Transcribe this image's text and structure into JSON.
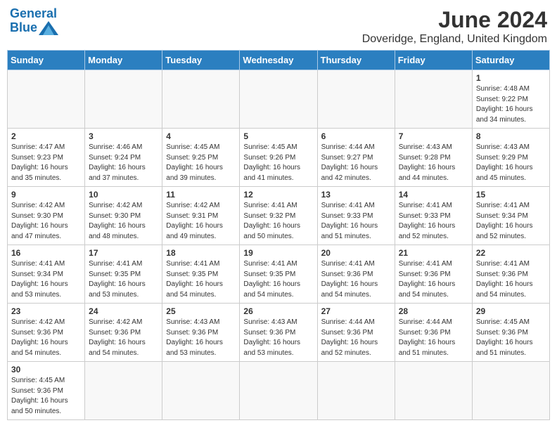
{
  "header": {
    "logo_line1": "General",
    "logo_line2": "Blue",
    "title": "June 2024",
    "subtitle": "Doveridge, England, United Kingdom"
  },
  "weekdays": [
    "Sunday",
    "Monday",
    "Tuesday",
    "Wednesday",
    "Thursday",
    "Friday",
    "Saturday"
  ],
  "weeks": [
    [
      {
        "day": "",
        "info": ""
      },
      {
        "day": "",
        "info": ""
      },
      {
        "day": "",
        "info": ""
      },
      {
        "day": "",
        "info": ""
      },
      {
        "day": "",
        "info": ""
      },
      {
        "day": "",
        "info": ""
      },
      {
        "day": "1",
        "info": "Sunrise: 4:48 AM\nSunset: 9:22 PM\nDaylight: 16 hours\nand 34 minutes."
      }
    ],
    [
      {
        "day": "2",
        "info": "Sunrise: 4:47 AM\nSunset: 9:23 PM\nDaylight: 16 hours\nand 35 minutes."
      },
      {
        "day": "3",
        "info": "Sunrise: 4:46 AM\nSunset: 9:24 PM\nDaylight: 16 hours\nand 37 minutes."
      },
      {
        "day": "4",
        "info": "Sunrise: 4:45 AM\nSunset: 9:25 PM\nDaylight: 16 hours\nand 39 minutes."
      },
      {
        "day": "5",
        "info": "Sunrise: 4:45 AM\nSunset: 9:26 PM\nDaylight: 16 hours\nand 41 minutes."
      },
      {
        "day": "6",
        "info": "Sunrise: 4:44 AM\nSunset: 9:27 PM\nDaylight: 16 hours\nand 42 minutes."
      },
      {
        "day": "7",
        "info": "Sunrise: 4:43 AM\nSunset: 9:28 PM\nDaylight: 16 hours\nand 44 minutes."
      },
      {
        "day": "8",
        "info": "Sunrise: 4:43 AM\nSunset: 9:29 PM\nDaylight: 16 hours\nand 45 minutes."
      }
    ],
    [
      {
        "day": "9",
        "info": "Sunrise: 4:42 AM\nSunset: 9:30 PM\nDaylight: 16 hours\nand 47 minutes."
      },
      {
        "day": "10",
        "info": "Sunrise: 4:42 AM\nSunset: 9:30 PM\nDaylight: 16 hours\nand 48 minutes."
      },
      {
        "day": "11",
        "info": "Sunrise: 4:42 AM\nSunset: 9:31 PM\nDaylight: 16 hours\nand 49 minutes."
      },
      {
        "day": "12",
        "info": "Sunrise: 4:41 AM\nSunset: 9:32 PM\nDaylight: 16 hours\nand 50 minutes."
      },
      {
        "day": "13",
        "info": "Sunrise: 4:41 AM\nSunset: 9:33 PM\nDaylight: 16 hours\nand 51 minutes."
      },
      {
        "day": "14",
        "info": "Sunrise: 4:41 AM\nSunset: 9:33 PM\nDaylight: 16 hours\nand 52 minutes."
      },
      {
        "day": "15",
        "info": "Sunrise: 4:41 AM\nSunset: 9:34 PM\nDaylight: 16 hours\nand 52 minutes."
      }
    ],
    [
      {
        "day": "16",
        "info": "Sunrise: 4:41 AM\nSunset: 9:34 PM\nDaylight: 16 hours\nand 53 minutes."
      },
      {
        "day": "17",
        "info": "Sunrise: 4:41 AM\nSunset: 9:35 PM\nDaylight: 16 hours\nand 53 minutes."
      },
      {
        "day": "18",
        "info": "Sunrise: 4:41 AM\nSunset: 9:35 PM\nDaylight: 16 hours\nand 54 minutes."
      },
      {
        "day": "19",
        "info": "Sunrise: 4:41 AM\nSunset: 9:35 PM\nDaylight: 16 hours\nand 54 minutes."
      },
      {
        "day": "20",
        "info": "Sunrise: 4:41 AM\nSunset: 9:36 PM\nDaylight: 16 hours\nand 54 minutes."
      },
      {
        "day": "21",
        "info": "Sunrise: 4:41 AM\nSunset: 9:36 PM\nDaylight: 16 hours\nand 54 minutes."
      },
      {
        "day": "22",
        "info": "Sunrise: 4:41 AM\nSunset: 9:36 PM\nDaylight: 16 hours\nand 54 minutes."
      }
    ],
    [
      {
        "day": "23",
        "info": "Sunrise: 4:42 AM\nSunset: 9:36 PM\nDaylight: 16 hours\nand 54 minutes."
      },
      {
        "day": "24",
        "info": "Sunrise: 4:42 AM\nSunset: 9:36 PM\nDaylight: 16 hours\nand 54 minutes."
      },
      {
        "day": "25",
        "info": "Sunrise: 4:43 AM\nSunset: 9:36 PM\nDaylight: 16 hours\nand 53 minutes."
      },
      {
        "day": "26",
        "info": "Sunrise: 4:43 AM\nSunset: 9:36 PM\nDaylight: 16 hours\nand 53 minutes."
      },
      {
        "day": "27",
        "info": "Sunrise: 4:44 AM\nSunset: 9:36 PM\nDaylight: 16 hours\nand 52 minutes."
      },
      {
        "day": "28",
        "info": "Sunrise: 4:44 AM\nSunset: 9:36 PM\nDaylight: 16 hours\nand 51 minutes."
      },
      {
        "day": "29",
        "info": "Sunrise: 4:45 AM\nSunset: 9:36 PM\nDaylight: 16 hours\nand 51 minutes."
      }
    ],
    [
      {
        "day": "30",
        "info": "Sunrise: 4:45 AM\nSunset: 9:36 PM\nDaylight: 16 hours\nand 50 minutes."
      },
      {
        "day": "",
        "info": ""
      },
      {
        "day": "",
        "info": ""
      },
      {
        "day": "",
        "info": ""
      },
      {
        "day": "",
        "info": ""
      },
      {
        "day": "",
        "info": ""
      },
      {
        "day": "",
        "info": ""
      }
    ]
  ]
}
